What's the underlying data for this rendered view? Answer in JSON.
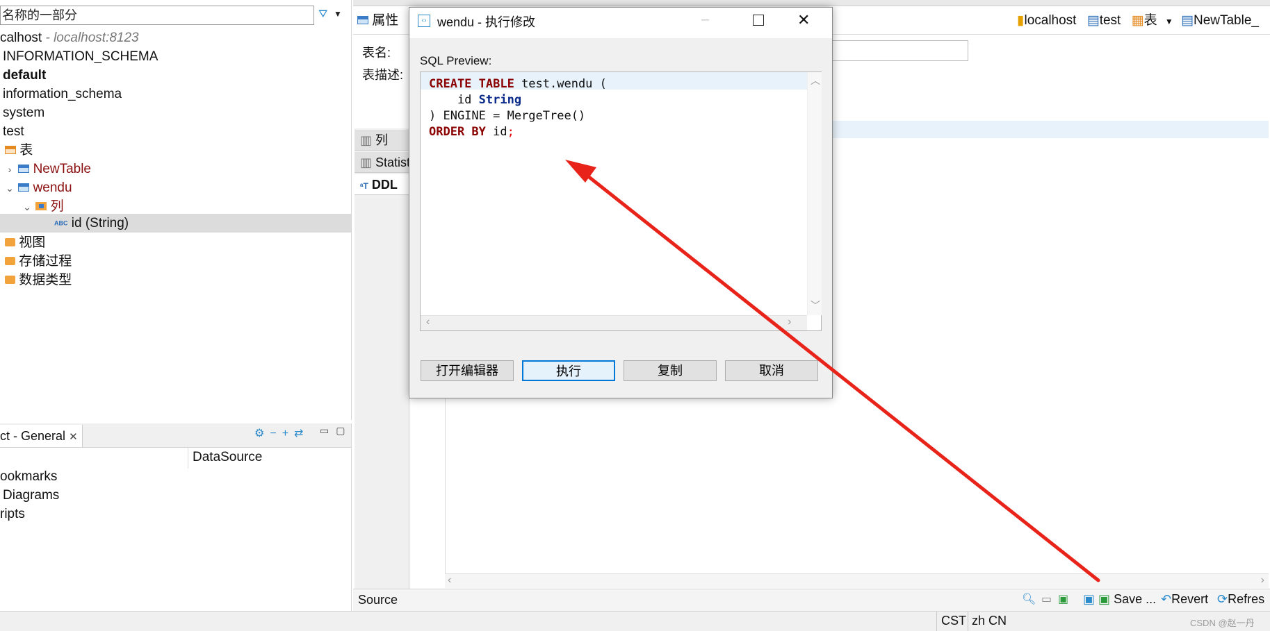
{
  "navigator": {
    "filter_placeholder": "名称的一部分",
    "tree": [
      {
        "label": "calhost",
        "suffix": " - localhost:8123"
      },
      {
        "label": "INFORMATION_SCHEMA"
      },
      {
        "label": "default"
      },
      {
        "label": "information_schema"
      },
      {
        "label": "system"
      },
      {
        "label": "test"
      },
      {
        "label": "表"
      },
      {
        "label": "NewTable"
      },
      {
        "label": "wendu"
      },
      {
        "label": "列"
      },
      {
        "label": "id (String)"
      },
      {
        "label": "视图"
      },
      {
        "label": "存储过程"
      },
      {
        "label": "数据类型"
      }
    ]
  },
  "project": {
    "tab_label": "ct - General",
    "column_header": "DataSource",
    "items": [
      "ookmarks",
      "Diagrams",
      "ripts"
    ]
  },
  "editor": {
    "toolbar_tab": "属性",
    "breadcrumbs": [
      "localhost",
      "test",
      "表",
      "NewTable_"
    ],
    "field_labels": [
      "表名:",
      "表描述:"
    ],
    "side_tabs": [
      "列",
      "Statist",
      "DDL"
    ],
    "source_label": "Source",
    "actions": [
      "Save ...",
      "Revert",
      "Refres"
    ]
  },
  "status": {
    "timezone": "CST",
    "locale": "zh CN",
    "watermark": "CSDN @赵一丹"
  },
  "dialog": {
    "title": "wendu - 执行修改",
    "preview_label": "SQL Preview:",
    "sql": {
      "line1_kw": "CREATE TABLE",
      "line1_rest": " test.wendu (",
      "line2_col": "    id ",
      "line2_type": "String",
      "line3": ") ENGINE = MergeTree()",
      "line4_kw": "ORDER BY",
      "line4_rest": " id",
      "line4_end": ";"
    },
    "buttons": {
      "open_editor": "打开编辑器",
      "execute": "执行",
      "copy": "复制",
      "cancel": "取消"
    }
  },
  "colors": {
    "annotation_arrow": "#e8231a",
    "accent": "#0078d7",
    "keyword": "#8b0000"
  }
}
